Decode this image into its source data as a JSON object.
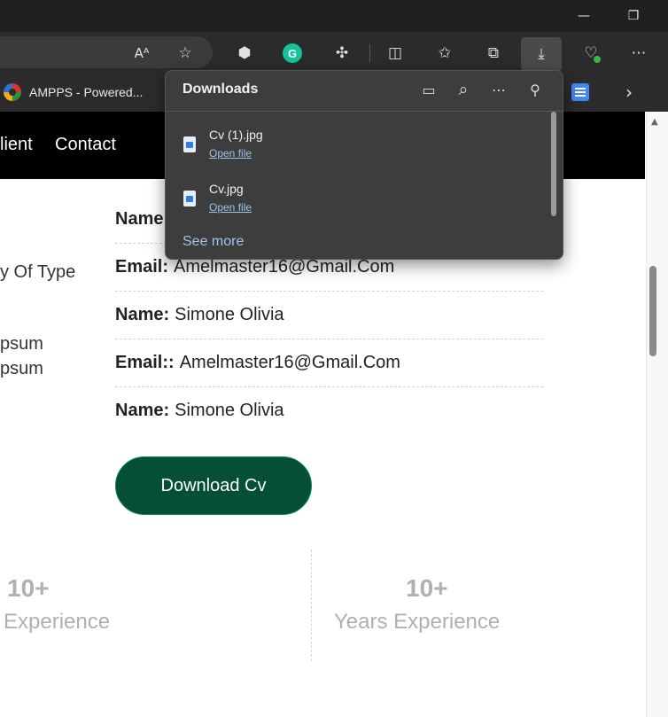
{
  "browser": {
    "window_controls": {
      "minimize": "—",
      "restore": "❐"
    },
    "toolbar_icons": {
      "read_aloud": "Aᴬ",
      "favorite": "☆",
      "copilot": "⬢",
      "grammarly": "G",
      "extensions": "✣",
      "split_screen": "◫",
      "favorites": "✩",
      "collections": "⧉",
      "downloads": "⤓",
      "health": "♡",
      "more": "⋯"
    },
    "favorites_bar": {
      "item_label": "AMPPS - Powered...",
      "chevron": "›"
    }
  },
  "downloads_panel": {
    "title": "Downloads",
    "icons": {
      "open_folder": "▭",
      "search": "⌕",
      "more": "⋯",
      "pin": "⚲"
    },
    "items": [
      {
        "name": "Cv (1).jpg",
        "action": "Open file"
      },
      {
        "name": "Cv.jpg",
        "action": "Open file"
      }
    ],
    "see_more": "See more"
  },
  "site": {
    "nav": {
      "client": "lient",
      "contact": "Contact"
    },
    "left_text": {
      "line1": "y Of Type",
      "line2": "psum",
      "line3": "psum"
    },
    "info_rows": [
      {
        "label": "Name:",
        "value": ""
      },
      {
        "label": "Email:",
        "value": "Amelmaster16@Gmail.Com"
      },
      {
        "label": "Name:",
        "value": "Simone Olivia"
      },
      {
        "label": "Email::",
        "value": "Amelmaster16@Gmail.Com"
      },
      {
        "label": "Name:",
        "value": "Simone Olivia"
      }
    ],
    "download_button": "Download Cv",
    "stats": [
      {
        "number": "10+",
        "label": "Experience"
      },
      {
        "number": "10+",
        "label": "Years Experience"
      }
    ]
  }
}
